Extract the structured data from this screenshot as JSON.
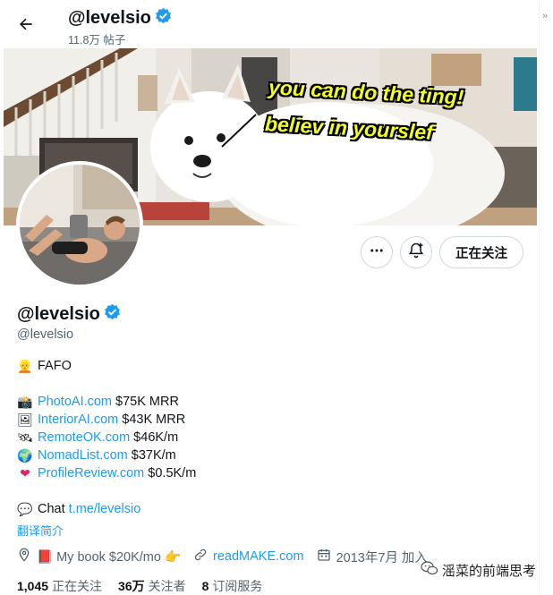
{
  "header": {
    "title": "@levelsio",
    "posts": "11.8万 帖子"
  },
  "banner": {
    "caption_line1": "you can do the ting!",
    "caption_line2": "believ in yourslef"
  },
  "actions": {
    "follow_label": "正在关注"
  },
  "profile": {
    "name": "@levelsio",
    "handle": "@levelsio",
    "bio": [
      {
        "icon": "person-emoji-icon",
        "glyph": "👱",
        "link": "",
        "text": "FAFO"
      },
      {
        "icon": "camera-emoji-icon",
        "glyph": "📸",
        "link": "PhotoAI.com",
        "text": " $75K MRR"
      },
      {
        "icon": "picture-emoji-icon",
        "glyph": "🖼",
        "link": "InteriorAI.com",
        "text": " $43K MRR"
      },
      {
        "icon": "satellite-emoji-icon",
        "glyph": "🛰",
        "link": "RemoteOK.com",
        "text": " $46K/m"
      },
      {
        "icon": "globe-emoji-icon",
        "glyph": "🌍",
        "link": "NomadList.com",
        "text": " $37K/m"
      },
      {
        "icon": "heart-fire-emoji-icon",
        "glyph": "❤",
        "link": "ProfileReview.com",
        "text": " $0.5K/m"
      }
    ],
    "chat": {
      "icon": "speech-bubble-emoji-icon",
      "glyph": "💬",
      "label": "Chat ",
      "link": "t.me/levelsio"
    },
    "translate": "翻译简介"
  },
  "meta": {
    "location": "📕 My book $20K/mo 👉",
    "website": "readMAKE.com",
    "joined": "2013年7月 加入"
  },
  "stats": {
    "following_count": "1,045",
    "following_label": "正在关注",
    "followers_count": "36万",
    "followers_label": "关注者",
    "subs_count": "8",
    "subs_label": "订阅服务"
  },
  "watermark": "滛菜的前端思考",
  "colors": {
    "accent": "#1d9bf0",
    "text": "#0f1419",
    "muted": "#536471",
    "border": "#cfd9de",
    "caption": "#f4ff26"
  }
}
